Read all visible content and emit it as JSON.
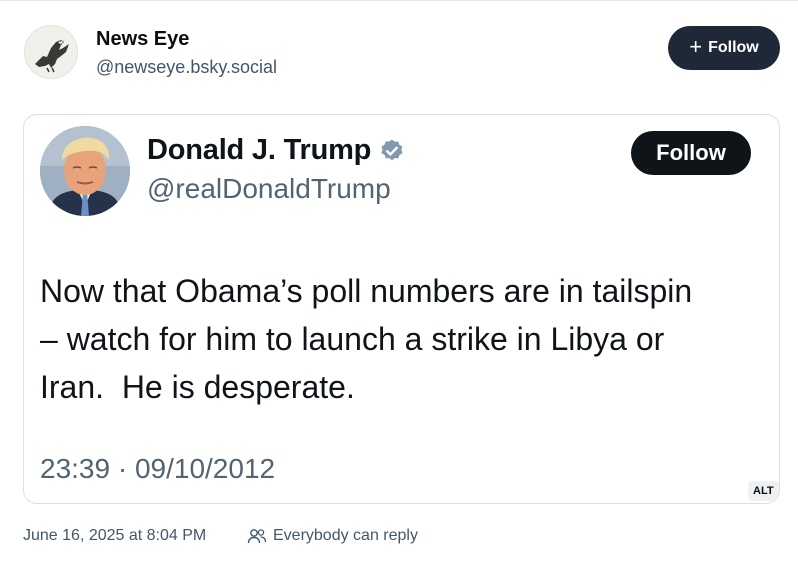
{
  "author": {
    "display_name": "News Eye",
    "handle": "@newseye.bsky.social",
    "avatar_icon": "eagle-logo-icon"
  },
  "follow_button": {
    "label": "Follow",
    "icon": "plus-icon"
  },
  "embedded_image": {
    "alt_badge": "ALT",
    "tweet": {
      "display_name": "Donald J. Trump",
      "verified_icon": "verified-badge-icon",
      "handle": "@realDonaldTrump",
      "follow_label": "Follow",
      "text": "Now that Obama’s poll numbers are in tailspin\n– watch for him to launch a strike in Libya or\nIran.  He is desperate.",
      "timestamp": "23:39 · 09/10/2012"
    }
  },
  "footer": {
    "posted_at": "June 16, 2025 at 8:04 PM",
    "reply_icon": "people-icon",
    "reply_setting": "Everybody can reply"
  },
  "colors": {
    "follow_button_bg": "#1e2836",
    "muted_text": "#42576c",
    "tweet_verified": "#829aab"
  }
}
